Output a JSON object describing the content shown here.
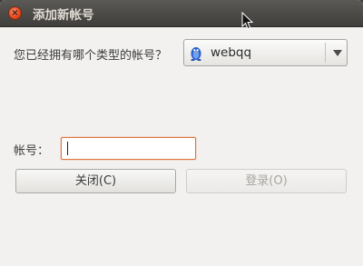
{
  "window": {
    "title": "添加新帐号",
    "close_glyph": "×"
  },
  "form": {
    "question": "您已经拥有哪个类型的帐号？",
    "account_type": {
      "selected": "webqq",
      "icon": "qq-penguin-icon"
    },
    "account_label": "帐号：",
    "account_value": ""
  },
  "buttons": {
    "close_label": "关闭(C)",
    "login_label": "登录(O)"
  },
  "colors": {
    "titlebar": "#3f3e3a",
    "window_bg": "#f2f1f0",
    "close_button": "#e1471c",
    "focus_border": "#e0743e",
    "disabled_text": "#a7a6a2"
  }
}
